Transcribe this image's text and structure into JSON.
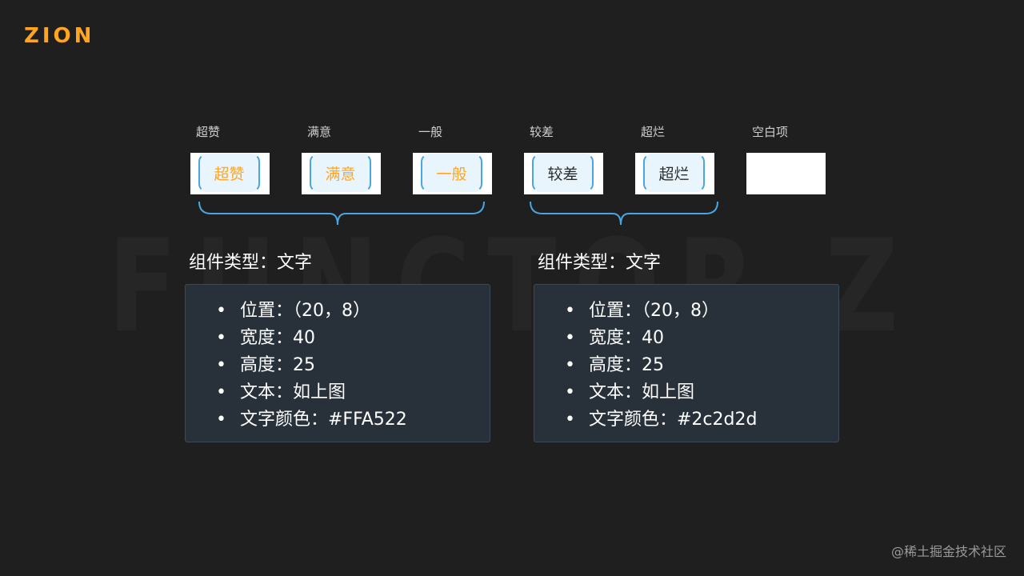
{
  "brand": {
    "logo_text": "ZION",
    "accent": "#ffa522"
  },
  "watermark": {
    "text": "FUNCTOR Z"
  },
  "columns": [
    {
      "label": "超赞",
      "chip": "超赞",
      "color": "orange"
    },
    {
      "label": "满意",
      "chip": "满意",
      "color": "orange"
    },
    {
      "label": "一般",
      "chip": "一般",
      "color": "orange"
    },
    {
      "label": "较差",
      "chip": "较差",
      "color": "dark"
    },
    {
      "label": "超烂",
      "chip": "超烂",
      "color": "dark"
    },
    {
      "label": "空白项",
      "chip": "",
      "color": "none"
    }
  ],
  "groups": [
    {
      "title": "组件类型：文字",
      "props": [
        "位置：（20，8）",
        "宽度：40",
        "高度：25",
        "文本：如上图",
        "文字颜色：#FFA522"
      ]
    },
    {
      "title": "组件类型：文字",
      "props": [
        "位置：（20，8）",
        "宽度：40",
        "高度：25",
        "文本：如上图",
        "文字颜色：#2c2d2d"
      ]
    }
  ],
  "footer": {
    "credit": "@稀土掘金技术社区"
  },
  "colors": {
    "background": "#1f1f1f",
    "chip_border": "#4aa6e0",
    "chip_fill": "#e8f5fc",
    "dark_text": "#2c2d2d",
    "box_fill": "#28313a"
  }
}
